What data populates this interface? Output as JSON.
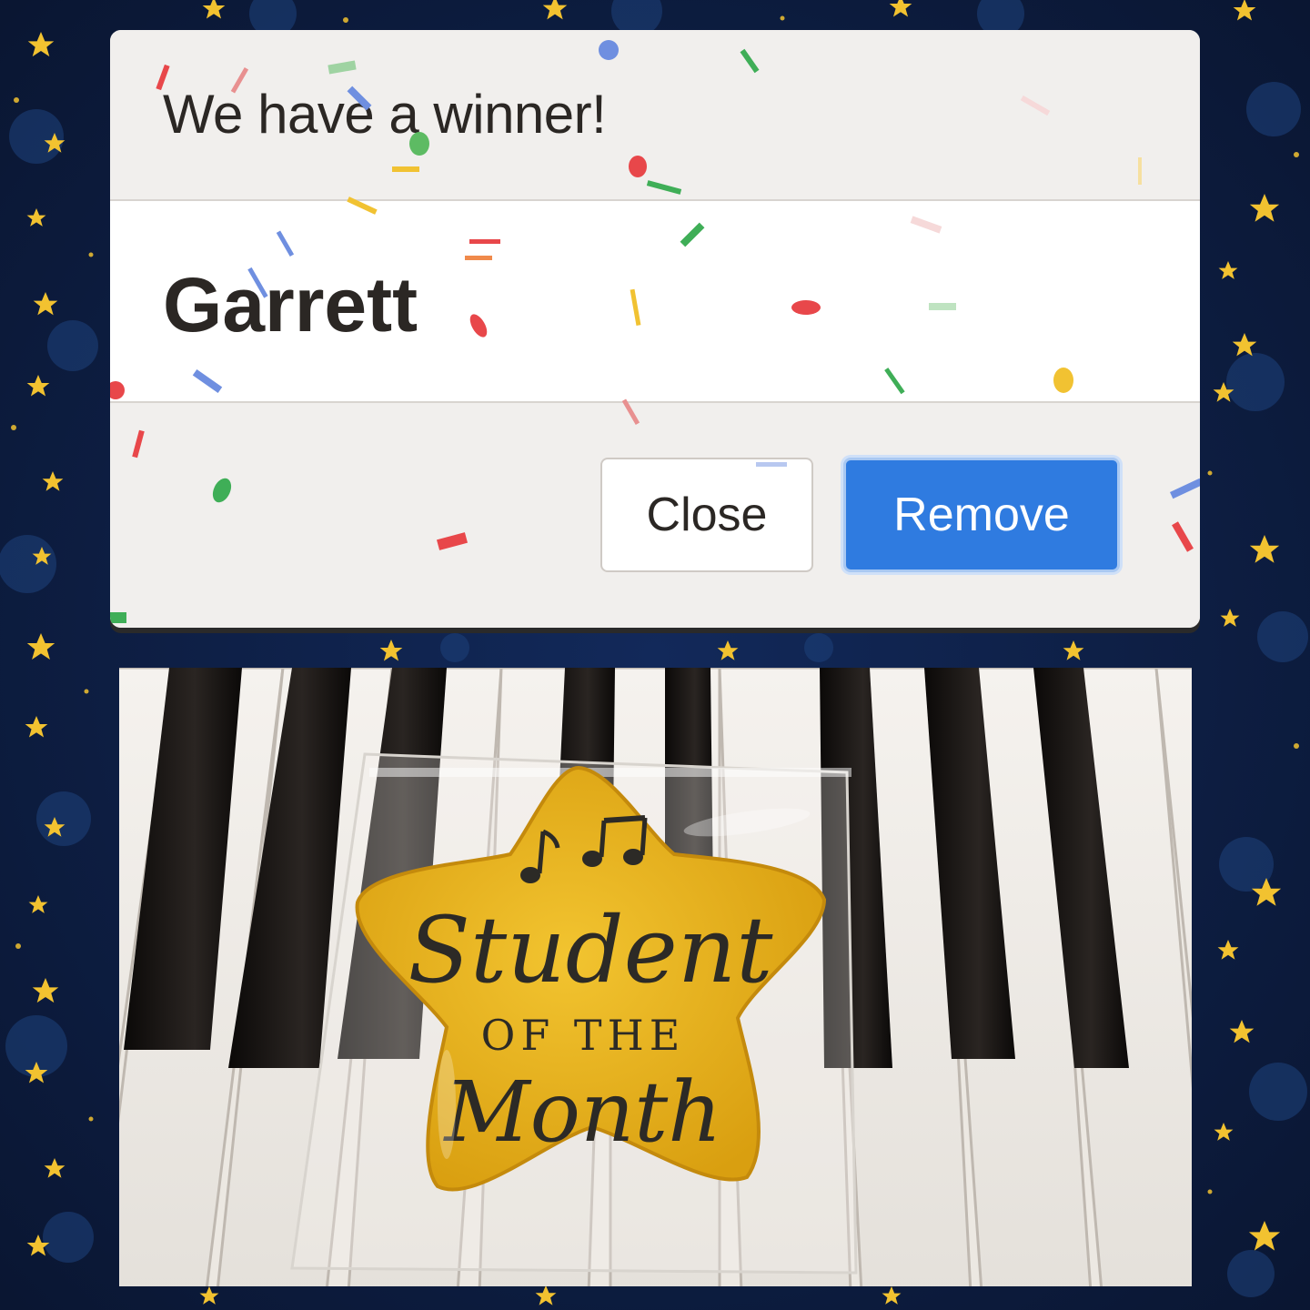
{
  "dialog": {
    "title": "We have a winner!",
    "winner_name": "Garrett",
    "buttons": {
      "close": "Close",
      "remove": "Remove"
    }
  },
  "photo": {
    "cookie_line1": "Student",
    "cookie_line2": "OF THE",
    "cookie_line3": "Month"
  },
  "colors": {
    "background": "#0d1b3d",
    "star": "#f2c230",
    "primary_button": "#2f7be0",
    "cookie": "#e6b21e"
  },
  "icons": [
    "star-icon",
    "music-note-icon"
  ]
}
